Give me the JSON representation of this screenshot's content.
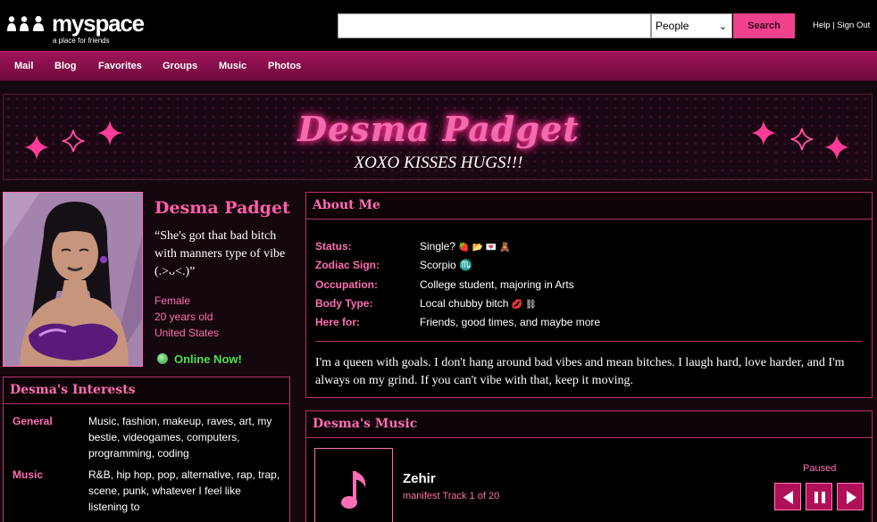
{
  "topbar": {
    "logo_text": "myspace",
    "logo_tagline": "a place for friends",
    "search": {
      "value": "",
      "placeholder": "",
      "category": "People",
      "button_label": "Search"
    },
    "help_label": "Help",
    "separator": "|",
    "signout_label": "Sign Out"
  },
  "nav": {
    "items": [
      "Mail",
      "Blog",
      "Favorites",
      "Groups",
      "Music",
      "Photos"
    ]
  },
  "banner": {
    "title": "Desma Padget",
    "subtitle": "XOXO KISSES HUGS!!!"
  },
  "profile": {
    "name": "Desma Padget",
    "quote": "“She's got that bad bitch with manners type of vibe (.>ᴗ<.)”",
    "gender": "Female",
    "age": "20 years old",
    "location": "United States",
    "online_status": "Online Now!"
  },
  "interests": {
    "title": "Desma's Interests",
    "items": [
      {
        "label": "General",
        "value": "Music, fashion, makeup, raves, art, my bestie, videogames, computers, programming, coding"
      },
      {
        "label": "Music",
        "value": "R&B, hip hop, pop, alternative, rap, trap, scene, punk, whatever I feel like listening to"
      }
    ]
  },
  "about": {
    "title": "About Me",
    "rows": [
      {
        "label": "Status:",
        "value": "Single?",
        "emoji": "🍓 📂 💌 🧸"
      },
      {
        "label": "Zodiac Sign:",
        "value": "Scorpio",
        "emoji": "♏"
      },
      {
        "label": "Occupation:",
        "value": "College student, majoring in Arts",
        "emoji": ""
      },
      {
        "label": "Body Type:",
        "value": "Local chubby bitch",
        "emoji": "💋 ⛓"
      },
      {
        "label": "Here for:",
        "value": "Friends, good times, and maybe more",
        "emoji": ""
      }
    ],
    "bio": "I'm a queen with goals. I don't hang around bad vibes and mean bitches. I laugh hard, love harder, and I'm always on my grind. If you can't vibe with that, keep it moving."
  },
  "music": {
    "title": "Desma's Music",
    "track_title": "Zehir",
    "track_subtitle": "manifest Track 1 of 20",
    "status": "Paused",
    "art_icon": "music-note-icon",
    "controls": [
      "prev-icon",
      "pause-icon",
      "next-icon"
    ]
  },
  "colors": {
    "accent": "#ff6eb4",
    "nav": "#a0135a",
    "search_button": "#f0418c",
    "online": "#4ee04e"
  }
}
